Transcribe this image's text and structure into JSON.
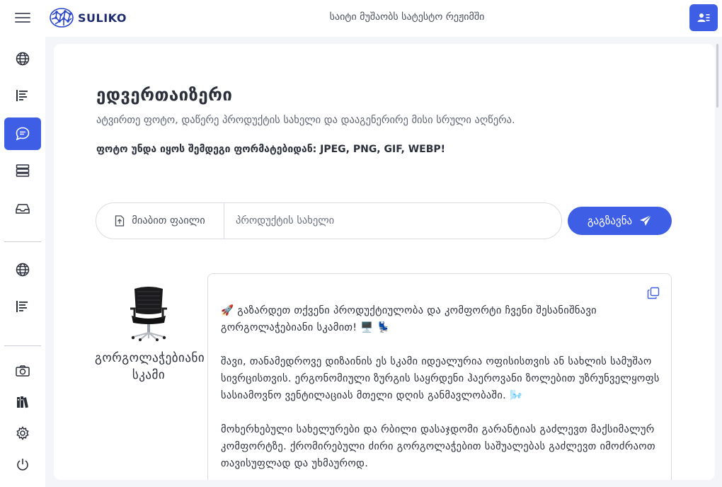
{
  "header": {
    "brand_name": "SULIKO",
    "status_text": "საიტი მუშაობს სატესტო რეჟიმში",
    "profile_icon": "user-profile-icon",
    "accent_color": "#3e5ee6"
  },
  "sidebar": {
    "items": [
      {
        "icon": "globe-icon"
      },
      {
        "icon": "text-lines-icon"
      },
      {
        "icon": "chat-icon",
        "active": true
      },
      {
        "icon": "list-stack-icon"
      },
      {
        "icon": "inbox-icon"
      },
      {
        "icon": "globe-icon"
      },
      {
        "icon": "text-lines-icon"
      },
      {
        "icon": "camera-icon"
      },
      {
        "icon": "books-icon"
      },
      {
        "icon": "gear-icon"
      },
      {
        "icon": "power-icon"
      }
    ]
  },
  "main": {
    "title": "ედვერთაიზერი",
    "subtitle": "ატვირთე ფოტო, დაწერე პროდუქტის სახელი და დააგენერირე მისი სრული აღწერა.",
    "formats_note": "ფოტო უნდა იყოს შემდეგი ფორმატებიდან: JPEG, PNG, GIF, WEBP!",
    "upload_label": "მიაბით ფაილი",
    "product_placeholder": "პროდუქტის სახელი",
    "product_value": "",
    "send_label": "გაგზავნა"
  },
  "result": {
    "product_name": "გორგოლაჭებიანი სკამი",
    "paragraphs": [
      "🚀 გაზარდეთ თქვენი პროდუქტიულობა და კომფორტი ჩვენი შესანიშნავი გორგოლაჭებიანი სკამით! 🖥️ 💺",
      "შავი, თანამედროვე დიზაინის ეს სკამი იდეალურია ოფისისთვის ან სახლის სამუშაო სივრცისთვის. ერგონომიული ზურგის საყრდენი ჰაეროვანი ზოლებით უზრუნველყოფს სასიამოვნო ვენტილაციას მთელი დღის განმავლობაში. 🌬️",
      "მოხერხებული სახელურები და რბილი დასაჯდომი გარანტიას გაძლევთ მაქსიმალურ კომფორტზე. ქრომირებული ძირი გორგოლაჭებით საშუალებას გაძლევთ იმოძრაოთ თავისუფლად და უხმაუროდ."
    ]
  }
}
